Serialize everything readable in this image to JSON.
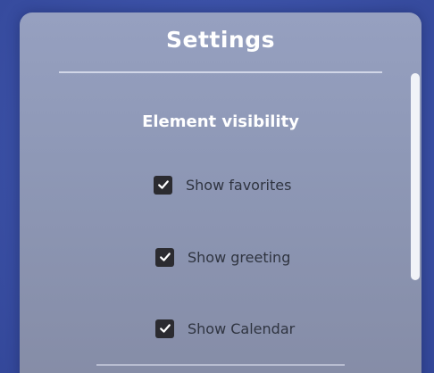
{
  "panel": {
    "title": "Settings",
    "section_title": "Element visibility",
    "options": [
      {
        "label": "Show favorites",
        "checked": true
      },
      {
        "label": "Show greeting",
        "checked": true
      },
      {
        "label": "Show Calendar",
        "checked": true
      }
    ]
  },
  "icons": {
    "checkbox_mark": "checkmark-icon"
  },
  "colors": {
    "background": "#3c52a8",
    "panel": "#8e98b6",
    "checkbox_fill": "#2b2b30",
    "title_text": "#ffffff",
    "option_text": "#2f3440"
  }
}
